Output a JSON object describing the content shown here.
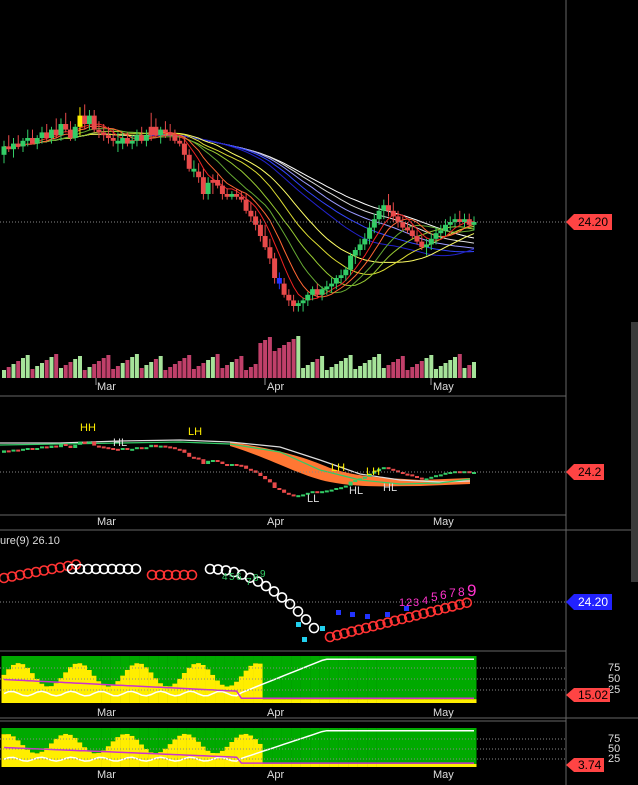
{
  "chart_data": [
    {
      "type": "candlestick",
      "panel": "price",
      "x_labels": [
        "Mar",
        "Apr",
        "May"
      ],
      "last_price": "24.20",
      "candles": [
        {
          "o": 26.6,
          "h": 27.1,
          "l": 26.3,
          "c": 26.9,
          "color": "green"
        },
        {
          "o": 26.9,
          "h": 27.3,
          "l": 26.7,
          "c": 26.8,
          "color": "red"
        },
        {
          "o": 26.8,
          "h": 27.2,
          "l": 26.5,
          "c": 27.0,
          "color": "green"
        },
        {
          "o": 27.0,
          "h": 27.3,
          "l": 26.8,
          "c": 26.9,
          "color": "red"
        },
        {
          "o": 26.9,
          "h": 27.2,
          "l": 26.7,
          "c": 27.1,
          "color": "green"
        },
        {
          "o": 27.1,
          "h": 27.5,
          "l": 26.9,
          "c": 27.2,
          "color": "green"
        },
        {
          "o": 27.2,
          "h": 27.5,
          "l": 27.0,
          "c": 27.0,
          "color": "red"
        },
        {
          "o": 27.0,
          "h": 27.3,
          "l": 26.8,
          "c": 27.2,
          "color": "green"
        },
        {
          "o": 27.2,
          "h": 27.6,
          "l": 27.0,
          "c": 27.4,
          "color": "green"
        },
        {
          "o": 27.4,
          "h": 27.7,
          "l": 27.1,
          "c": 27.2,
          "color": "red"
        },
        {
          "o": 27.2,
          "h": 27.6,
          "l": 27.0,
          "c": 27.5,
          "color": "green"
        },
        {
          "o": 27.5,
          "h": 27.9,
          "l": 27.2,
          "c": 27.3,
          "color": "red"
        },
        {
          "o": 27.3,
          "h": 27.9,
          "l": 27.1,
          "c": 27.7,
          "color": "green"
        },
        {
          "o": 27.7,
          "h": 28.1,
          "l": 27.4,
          "c": 27.5,
          "color": "red"
        },
        {
          "o": 27.5,
          "h": 27.8,
          "l": 27.1,
          "c": 27.2,
          "color": "red"
        },
        {
          "o": 27.2,
          "h": 27.7,
          "l": 27.1,
          "c": 27.6,
          "color": "green"
        },
        {
          "o": 27.6,
          "h": 28.3,
          "l": 27.3,
          "c": 28.0,
          "color": "yellow"
        },
        {
          "o": 28.0,
          "h": 28.4,
          "l": 27.5,
          "c": 27.7,
          "color": "red"
        },
        {
          "o": 27.7,
          "h": 28.2,
          "l": 27.5,
          "c": 28.0,
          "color": "green"
        },
        {
          "o": 28.0,
          "h": 28.2,
          "l": 27.4,
          "c": 27.5,
          "color": "red"
        },
        {
          "o": 27.5,
          "h": 27.8,
          "l": 27.2,
          "c": 27.4,
          "color": "red"
        },
        {
          "o": 27.4,
          "h": 27.7,
          "l": 27.1,
          "c": 27.3,
          "color": "red"
        },
        {
          "o": 27.3,
          "h": 27.6,
          "l": 27.0,
          "c": 27.2,
          "color": "red"
        },
        {
          "o": 27.2,
          "h": 27.5,
          "l": 26.9,
          "c": 27.1,
          "color": "red"
        },
        {
          "o": 27.1,
          "h": 27.4,
          "l": 26.7,
          "c": 27.0,
          "color": "green"
        },
        {
          "o": 27.0,
          "h": 27.4,
          "l": 26.8,
          "c": 27.2,
          "color": "green"
        },
        {
          "o": 27.2,
          "h": 27.4,
          "l": 26.9,
          "c": 27.0,
          "color": "red"
        },
        {
          "o": 27.0,
          "h": 27.3,
          "l": 26.8,
          "c": 27.1,
          "color": "green"
        },
        {
          "o": 27.1,
          "h": 27.5,
          "l": 26.9,
          "c": 27.3,
          "color": "green"
        },
        {
          "o": 27.3,
          "h": 27.6,
          "l": 27.0,
          "c": 27.1,
          "color": "red"
        },
        {
          "o": 27.1,
          "h": 27.5,
          "l": 26.9,
          "c": 27.3,
          "color": "green"
        },
        {
          "o": 27.3,
          "h": 28.1,
          "l": 27.1,
          "c": 27.6,
          "color": "red"
        },
        {
          "o": 27.6,
          "h": 27.9,
          "l": 27.2,
          "c": 27.3,
          "color": "red"
        },
        {
          "o": 27.3,
          "h": 27.6,
          "l": 27.0,
          "c": 27.5,
          "color": "green"
        },
        {
          "o": 27.5,
          "h": 27.8,
          "l": 27.2,
          "c": 27.4,
          "color": "red"
        },
        {
          "o": 27.4,
          "h": 27.7,
          "l": 27.1,
          "c": 27.3,
          "color": "red"
        },
        {
          "o": 27.3,
          "h": 27.5,
          "l": 27.0,
          "c": 27.1,
          "color": "red"
        },
        {
          "o": 27.1,
          "h": 27.3,
          "l": 26.9,
          "c": 27.0,
          "color": "red"
        },
        {
          "o": 27.0,
          "h": 27.2,
          "l": 26.4,
          "c": 26.6,
          "color": "red"
        },
        {
          "o": 26.6,
          "h": 26.8,
          "l": 26.0,
          "c": 26.1,
          "color": "red"
        },
        {
          "o": 26.1,
          "h": 26.4,
          "l": 25.8,
          "c": 26.0,
          "color": "green"
        },
        {
          "o": 26.0,
          "h": 26.3,
          "l": 25.6,
          "c": 25.8,
          "color": "red"
        },
        {
          "o": 25.8,
          "h": 26.1,
          "l": 25.0,
          "c": 25.2,
          "color": "red"
        },
        {
          "o": 25.2,
          "h": 25.8,
          "l": 25.0,
          "c": 25.6,
          "color": "green"
        },
        {
          "o": 25.6,
          "h": 25.9,
          "l": 25.2,
          "c": 25.7,
          "color": "red"
        },
        {
          "o": 25.7,
          "h": 25.9,
          "l": 25.4,
          "c": 25.5,
          "color": "red"
        },
        {
          "o": 25.5,
          "h": 25.7,
          "l": 25.0,
          "c": 25.2,
          "color": "red"
        },
        {
          "o": 25.2,
          "h": 25.4,
          "l": 25.0,
          "c": 25.1,
          "color": "red"
        },
        {
          "o": 25.1,
          "h": 25.3,
          "l": 25.0,
          "c": 25.2,
          "color": "green"
        },
        {
          "o": 25.2,
          "h": 25.4,
          "l": 25.0,
          "c": 25.1,
          "color": "red"
        },
        {
          "o": 25.1,
          "h": 25.3,
          "l": 24.9,
          "c": 25.0,
          "color": "red"
        },
        {
          "o": 25.0,
          "h": 25.2,
          "l": 24.5,
          "c": 24.6,
          "color": "red"
        },
        {
          "o": 24.6,
          "h": 24.9,
          "l": 24.2,
          "c": 24.4,
          "color": "red"
        },
        {
          "o": 24.4,
          "h": 24.6,
          "l": 23.9,
          "c": 24.1,
          "color": "red"
        },
        {
          "o": 24.1,
          "h": 24.3,
          "l": 23.5,
          "c": 23.7,
          "color": "red"
        },
        {
          "o": 23.7,
          "h": 24.1,
          "l": 23.2,
          "c": 23.3,
          "color": "red"
        },
        {
          "o": 23.3,
          "h": 23.6,
          "l": 22.7,
          "c": 22.9,
          "color": "red"
        },
        {
          "o": 22.9,
          "h": 23.1,
          "l": 22.0,
          "c": 22.2,
          "color": "red"
        },
        {
          "o": 22.2,
          "h": 22.4,
          "l": 21.8,
          "c": 22.0,
          "color": "blue"
        },
        {
          "o": 22.0,
          "h": 22.2,
          "l": 21.5,
          "c": 21.6,
          "color": "red"
        },
        {
          "o": 21.6,
          "h": 21.8,
          "l": 21.2,
          "c": 21.4,
          "color": "red"
        },
        {
          "o": 21.4,
          "h": 21.6,
          "l": 21.0,
          "c": 21.2,
          "color": "red"
        },
        {
          "o": 21.2,
          "h": 21.4,
          "l": 21.0,
          "c": 21.3,
          "color": "green"
        },
        {
          "o": 21.3,
          "h": 21.5,
          "l": 21.0,
          "c": 21.4,
          "color": "green"
        },
        {
          "o": 21.4,
          "h": 21.7,
          "l": 21.2,
          "c": 21.6,
          "color": "green"
        },
        {
          "o": 21.6,
          "h": 21.9,
          "l": 21.4,
          "c": 21.8,
          "color": "green"
        },
        {
          "o": 21.8,
          "h": 22.0,
          "l": 21.5,
          "c": 21.6,
          "color": "red"
        },
        {
          "o": 21.6,
          "h": 21.9,
          "l": 21.4,
          "c": 21.8,
          "color": "green"
        },
        {
          "o": 21.8,
          "h": 22.1,
          "l": 21.6,
          "c": 21.9,
          "color": "green"
        },
        {
          "o": 21.9,
          "h": 22.2,
          "l": 21.7,
          "c": 22.0,
          "color": "green"
        },
        {
          "o": 22.0,
          "h": 22.3,
          "l": 21.8,
          "c": 22.2,
          "color": "green"
        },
        {
          "o": 22.2,
          "h": 22.5,
          "l": 22.0,
          "c": 22.3,
          "color": "green"
        },
        {
          "o": 22.3,
          "h": 22.6,
          "l": 22.1,
          "c": 22.5,
          "color": "green"
        },
        {
          "o": 22.5,
          "h": 23.1,
          "l": 22.3,
          "c": 23.0,
          "color": "green"
        },
        {
          "o": 23.0,
          "h": 23.3,
          "l": 22.7,
          "c": 23.2,
          "color": "green"
        },
        {
          "o": 23.2,
          "h": 23.6,
          "l": 23.0,
          "c": 23.4,
          "color": "green"
        },
        {
          "o": 23.4,
          "h": 23.8,
          "l": 23.2,
          "c": 23.6,
          "color": "green"
        },
        {
          "o": 23.6,
          "h": 24.2,
          "l": 23.4,
          "c": 24.0,
          "color": "green"
        },
        {
          "o": 24.0,
          "h": 24.5,
          "l": 23.8,
          "c": 24.3,
          "color": "green"
        },
        {
          "o": 24.3,
          "h": 24.8,
          "l": 24.1,
          "c": 24.6,
          "color": "green"
        },
        {
          "o": 24.6,
          "h": 25.0,
          "l": 24.3,
          "c": 24.8,
          "color": "green"
        },
        {
          "o": 24.8,
          "h": 25.2,
          "l": 24.4,
          "c": 24.6,
          "color": "red"
        },
        {
          "o": 24.6,
          "h": 24.9,
          "l": 24.2,
          "c": 24.4,
          "color": "red"
        },
        {
          "o": 24.4,
          "h": 24.6,
          "l": 24.0,
          "c": 24.2,
          "color": "red"
        },
        {
          "o": 24.2,
          "h": 24.4,
          "l": 23.9,
          "c": 24.0,
          "color": "red"
        },
        {
          "o": 24.0,
          "h": 24.2,
          "l": 23.8,
          "c": 23.9,
          "color": "red"
        },
        {
          "o": 23.9,
          "h": 24.1,
          "l": 23.6,
          "c": 23.7,
          "color": "red"
        },
        {
          "o": 23.7,
          "h": 23.9,
          "l": 23.4,
          "c": 23.5,
          "color": "red"
        },
        {
          "o": 23.5,
          "h": 23.7,
          "l": 23.2,
          "c": 23.3,
          "color": "red"
        },
        {
          "o": 23.3,
          "h": 23.6,
          "l": 23.0,
          "c": 23.4,
          "color": "green"
        },
        {
          "o": 23.4,
          "h": 23.8,
          "l": 23.2,
          "c": 23.6,
          "color": "green"
        },
        {
          "o": 23.6,
          "h": 24.0,
          "l": 23.4,
          "c": 23.8,
          "color": "green"
        },
        {
          "o": 23.8,
          "h": 24.1,
          "l": 23.6,
          "c": 23.9,
          "color": "green"
        },
        {
          "o": 23.9,
          "h": 24.3,
          "l": 23.7,
          "c": 24.1,
          "color": "green"
        },
        {
          "o": 24.1,
          "h": 24.4,
          "l": 23.9,
          "c": 24.2,
          "color": "green"
        },
        {
          "o": 24.2,
          "h": 24.5,
          "l": 24.0,
          "c": 24.3,
          "color": "green"
        },
        {
          "o": 24.3,
          "h": 24.6,
          "l": 24.1,
          "c": 24.2,
          "color": "red"
        },
        {
          "o": 24.2,
          "h": 24.5,
          "l": 24.0,
          "c": 24.3,
          "color": "green"
        },
        {
          "o": 24.3,
          "h": 24.5,
          "l": 24.0,
          "c": 24.1,
          "color": "red"
        },
        {
          "o": 24.1,
          "h": 24.4,
          "l": 23.9,
          "c": 24.2,
          "color": "green"
        }
      ]
    },
    {
      "type": "heikin-ashi",
      "panel": "swing",
      "x_labels": [
        "Mar",
        "Apr",
        "May"
      ],
      "last_price": "24.2",
      "annotations": [
        "HH",
        "HL",
        "LH",
        "LL",
        "LH",
        "HL",
        "LH",
        "HL"
      ]
    },
    {
      "type": "point-and-figure",
      "panel": "pnf",
      "title": "ure(9) 26.10",
      "count_labels_early": [
        "4",
        "5",
        "6",
        "7",
        "8",
        "9"
      ],
      "count_labels_late": [
        "1",
        "2",
        "3",
        "4",
        "5",
        "6",
        "7",
        "8",
        "9"
      ],
      "last_price": "24.20"
    },
    {
      "type": "stochastic",
      "panel": "stoch1",
      "x_labels": [
        "Mar",
        "Apr",
        "May"
      ],
      "y_ticks": [
        "75",
        "50",
        "25"
      ],
      "last_value": "15.02"
    },
    {
      "type": "stochastic",
      "panel": "stoch2",
      "x_labels": [
        "Mar",
        "Apr",
        "May"
      ],
      "y_ticks": [
        "75",
        "50",
        "25"
      ],
      "last_value": "3.74"
    }
  ],
  "colors": {
    "background": "#000000",
    "up": "#33cc66",
    "down": "#e84a4a",
    "highlight_yellow": "#ffee00",
    "magenta": "#ff33cc",
    "blue": "#2233ff",
    "cyan": "#22d0ee",
    "orange": "#ff7733",
    "price_badge": "#ff4444",
    "pnf_badge": "#2222ff"
  }
}
